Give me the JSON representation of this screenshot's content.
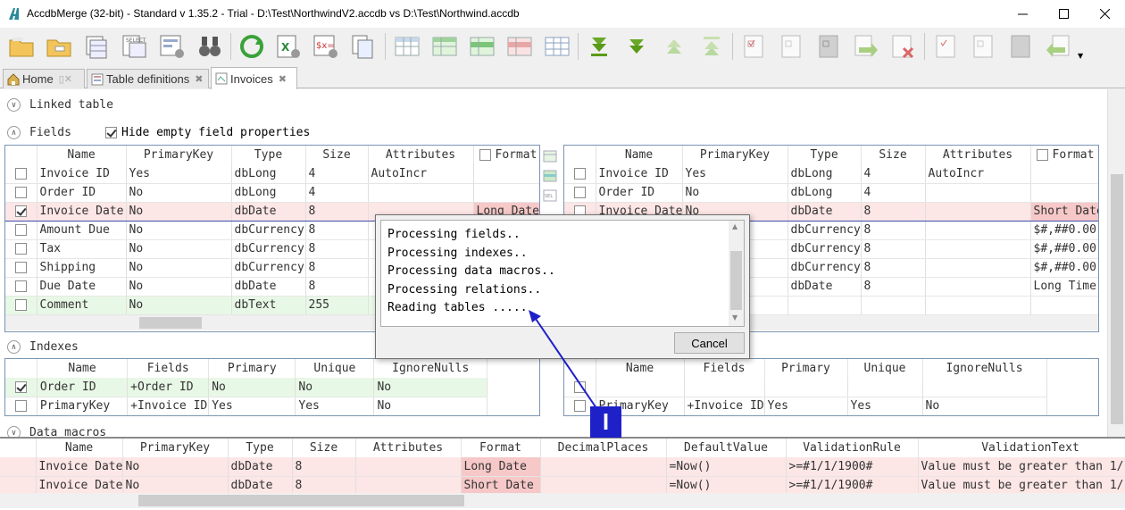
{
  "window": {
    "title": "AccdbMerge (32-bit) - Standard v 1.35.2 - Trial - D:\\Test\\NorthwindV2.accdb vs D:\\Test\\Northwind.accdb"
  },
  "tabs": [
    {
      "label": "Home"
    },
    {
      "label": "Table definitions"
    },
    {
      "label": "Invoices"
    }
  ],
  "sections": {
    "linked_table": "Linked table",
    "fields": "Fields",
    "hide_empty": "Hide empty field properties",
    "indexes": "Indexes",
    "data_macros": "Data macros"
  },
  "fields_left": {
    "columns": [
      "Name",
      "PrimaryKey",
      "Type",
      "Size",
      "Attributes",
      "Format"
    ],
    "rows": [
      {
        "checked": false,
        "name": "Invoice ID",
        "pk": "Yes",
        "type": "dbLong",
        "size": "4",
        "attr": "AutoIncr",
        "format": ""
      },
      {
        "checked": false,
        "name": "Order ID",
        "pk": "No",
        "type": "dbLong",
        "size": "4",
        "attr": "",
        "format": ""
      },
      {
        "checked": true,
        "name": "Invoice Date",
        "pk": "No",
        "type": "dbDate",
        "size": "8",
        "attr": "",
        "format": "Long Date"
      },
      {
        "checked": false,
        "name": "Amount Due",
        "pk": "No",
        "type": "dbCurrency",
        "size": "8",
        "attr": "",
        "format": ""
      },
      {
        "checked": false,
        "name": "Tax",
        "pk": "No",
        "type": "dbCurrency",
        "size": "8",
        "attr": "",
        "format": ""
      },
      {
        "checked": false,
        "name": "Shipping",
        "pk": "No",
        "type": "dbCurrency",
        "size": "8",
        "attr": "",
        "format": ""
      },
      {
        "checked": false,
        "name": "Due Date",
        "pk": "No",
        "type": "dbDate",
        "size": "8",
        "attr": "",
        "format": ""
      },
      {
        "checked": false,
        "name": "Comment",
        "pk": "No",
        "type": "dbText",
        "size": "255",
        "attr": "",
        "format": ""
      }
    ]
  },
  "fields_right": {
    "columns": [
      "Name",
      "PrimaryKey",
      "Type",
      "Size",
      "Attributes",
      "Format"
    ],
    "rows": [
      {
        "name": "Invoice ID",
        "pk": "Yes",
        "type": "dbLong",
        "size": "4",
        "attr": "AutoIncr",
        "format": ""
      },
      {
        "name": "Order ID",
        "pk": "No",
        "type": "dbLong",
        "size": "4",
        "attr": "",
        "format": ""
      },
      {
        "name": "Invoice Date",
        "pk": "No",
        "type": "dbDate",
        "size": "8",
        "attr": "",
        "format": "Short Date"
      },
      {
        "name": "",
        "pk": "",
        "type": "dbCurrency",
        "size": "8",
        "attr": "",
        "format": "$#,##0.00"
      },
      {
        "name": "",
        "pk": "",
        "type": "dbCurrency",
        "size": "8",
        "attr": "",
        "format": "$#,##0.00"
      },
      {
        "name": "",
        "pk": "",
        "type": "dbCurrency",
        "size": "8",
        "attr": "",
        "format": "$#,##0.00"
      },
      {
        "name": "",
        "pk": "",
        "type": "dbDate",
        "size": "8",
        "attr": "",
        "format": "Long Time"
      }
    ]
  },
  "indexes_left": {
    "columns": [
      "Name",
      "Fields",
      "Primary",
      "Unique",
      "IgnoreNulls"
    ],
    "rows": [
      {
        "checked": true,
        "name": "Order ID",
        "fields": "+Order ID",
        "primary": "No",
        "unique": "No",
        "ignore": "No"
      },
      {
        "checked": false,
        "name": "PrimaryKey",
        "fields": "+Invoice ID",
        "primary": "Yes",
        "unique": "Yes",
        "ignore": "No"
      }
    ]
  },
  "indexes_right": {
    "columns": [
      "Name",
      "Fields",
      "Primary",
      "Unique",
      "IgnoreNulls"
    ],
    "rows": [
      {
        "name": "",
        "fields": "",
        "primary": "",
        "unique": "",
        "ignore": ""
      },
      {
        "name": "PrimaryKey",
        "fields": "+Invoice ID",
        "primary": "Yes",
        "unique": "Yes",
        "ignore": "No"
      }
    ]
  },
  "bottom_grid": {
    "columns": [
      "Name",
      "PrimaryKey",
      "Type",
      "Size",
      "Attributes",
      "Format",
      "DecimalPlaces",
      "DefaultValue",
      "ValidationRule",
      "ValidationText"
    ],
    "rows": [
      {
        "name": "Invoice Date",
        "pk": "No",
        "type": "dbDate",
        "size": "8",
        "attr": "",
        "format": "Long Date",
        "dec": "",
        "def": "=Now()",
        "rule": ">=#1/1/1900#",
        "text": "Value must be greater than 1/1/"
      },
      {
        "name": "Invoice Date",
        "pk": "No",
        "type": "dbDate",
        "size": "8",
        "attr": "",
        "format": "Short Date",
        "dec": "",
        "def": "=Now()",
        "rule": ">=#1/1/1900#",
        "text": "Value must be greater than 1/1/"
      }
    ]
  },
  "dialog": {
    "lines": [
      "Processing fields..",
      "Processing indexes..",
      "Processing data macros..",
      "Processing relations..",
      "Reading tables ....."
    ],
    "cancel_label": "Cancel"
  },
  "annotation": {
    "badge": "I",
    "color": "#1e20c8"
  }
}
